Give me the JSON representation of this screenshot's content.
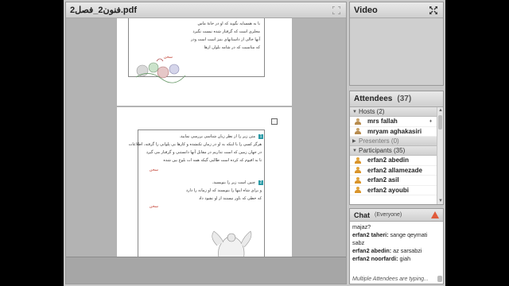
{
  "share_pod": {
    "title": "فنون2_فصل2.pdf",
    "fullscreen_icon": "expand-icon",
    "page1_lines": [
      "با به همسایه نگوید که او در خانهٔ ماس",
      "مجلزی است که گرفتار شده نیست نگیرد",
      "آنها خالی از داستانهای بنیز است است ودر",
      "که مناسبت که در شامه بلوان ازها"
    ],
    "page2_lines_a": [
      "متن زیر را از نظر زبان شناسی بررسی نمایید.",
      "هرگز کسی را با اینکه به او در زمان تکنشده و کارها بی پلوانی را گرفته، اطلاعات",
      "در جهان زمین که است نداریم در مقابل آنها دانستنی و گرفتار می گیرد",
      "تا به اقیوم که کرده است طالبی گیکه همه ات بلوغ بین شده"
    ],
    "page2_lines_b": [
      "چنین است زیر را بنویسید.",
      "و برای شاه اینها را بنویسند که او زمانه را دارد",
      "که خطی که باور نیستند از او نشود داد"
    ],
    "red_note": "سخن",
    "num_1": "1",
    "num_2": "2"
  },
  "video_pod": {
    "title": "Video",
    "fullscreen_icon": "expand-icon"
  },
  "attendees": {
    "title": "Attendees",
    "count": "(37)",
    "hosts_header": "Hosts (2)",
    "hosts": [
      "mrs fallah",
      "mryam aghakasiri"
    ],
    "presenters_header": "Presenters (0)",
    "participants_header": "Participants (35)",
    "participants": [
      "erfan2 abedin",
      "erfan2 allamezade",
      "erfan2 asil",
      "erfan2 ayoubi"
    ]
  },
  "chat": {
    "title": "Chat",
    "scope": "(Everyone)",
    "messages": [
      {
        "who": "",
        "text": "majaz?"
      },
      {
        "who": "erfan2 taheri:",
        "text": " sange qeymati sabz"
      },
      {
        "who": "erfan2 abedin:",
        "text": " az sarsabzi"
      },
      {
        "who": "erfan2 noorfardi:",
        "text": " giah"
      }
    ],
    "typing": "Multiple Attendees are typing...",
    "warn_icon": "alert-icon"
  },
  "colors": {
    "accent_teal": "#2a9aa6",
    "alert": "#e05a3a"
  }
}
